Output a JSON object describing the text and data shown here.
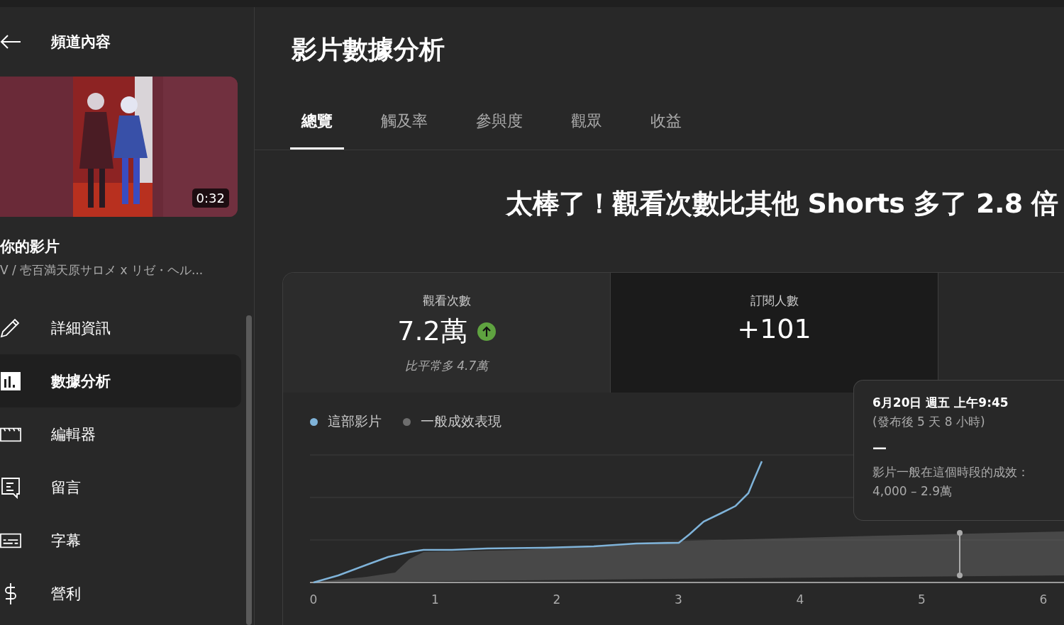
{
  "sidebar": {
    "title": "頻道內容",
    "video": {
      "kind": "picture",
      "duration": "0:32",
      "title": "你的影片",
      "subtitle": "V / 壱百満天原サロメ x リゼ・ヘル..."
    },
    "items": [
      {
        "kind": "pencil",
        "label": "詳細資訊",
        "selected": false
      },
      {
        "kind": "analytics",
        "label": "數據分析",
        "selected": true
      },
      {
        "kind": "clapper",
        "label": "編輯器",
        "selected": false
      },
      {
        "kind": "comment",
        "label": "留言",
        "selected": false
      },
      {
        "kind": "subtitles",
        "label": "字幕",
        "selected": false
      },
      {
        "kind": "dollar",
        "label": "營利",
        "selected": false
      }
    ]
  },
  "page": {
    "title": "影片數據分析",
    "tabs": [
      {
        "label": "總覽",
        "selected": true
      },
      {
        "label": "觸及率",
        "selected": false
      },
      {
        "label": "參與度",
        "selected": false
      },
      {
        "label": "觀眾",
        "selected": false
      },
      {
        "label": "收益",
        "selected": false
      }
    ],
    "headline": "太棒了！觀看次數比其他 Shorts 多了 2.8 倍",
    "metrics": [
      {
        "label": "觀看次數",
        "value": "7.2萬",
        "kind": "rising",
        "note": "比平常多 4.7萬",
        "selected": true
      },
      {
        "label": "訂閱人數",
        "value": "+101",
        "kind": "plain",
        "selected": false
      }
    ],
    "legend": [
      {
        "label": "這部影片",
        "color": "#7fb3d9"
      },
      {
        "label": "一般成效表現",
        "color": "#6e6e6e"
      }
    ],
    "x_labels": [
      "0",
      "1",
      "2",
      "3",
      "4",
      "5",
      "6"
    ],
    "tooltip": {
      "date": "6月20日 週五 上午9:45",
      "since": "(發布後 5 天 8 小時)",
      "dash": "—",
      "caption": "影片一般在這個時段的成效：",
      "range": "4,000 – 2.9萬"
    }
  }
}
